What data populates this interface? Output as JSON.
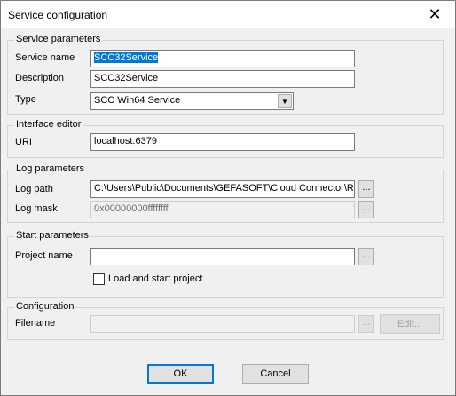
{
  "window": {
    "title": "Service configuration",
    "close_glyph": "✕"
  },
  "service_parameters": {
    "title": "Service parameters",
    "service_name_label": "Service name",
    "service_name_value": "SCC32Service",
    "description_label": "Description",
    "description_value": "SCC32Service",
    "type_label": "Type",
    "type_value": "SCC Win64 Service",
    "dropdown_glyph": "▼"
  },
  "interface_editor": {
    "title": "Interface editor",
    "uri_label": "URI",
    "uri_value": "localhost:6379"
  },
  "log_parameters": {
    "title": "Log parameters",
    "log_path_label": "Log path",
    "log_path_value": "C:\\Users\\Public\\Documents\\GEFASOFT\\Cloud Connector\\R",
    "log_mask_label": "Log mask",
    "log_mask_value": "0x00000000ffffffff",
    "browse_label": "..."
  },
  "start_parameters": {
    "title": "Start parameters",
    "project_name_label": "Project name",
    "project_name_value": "",
    "load_start_label": "Load and start project",
    "browse_label": "..."
  },
  "configuration": {
    "title": "Configuration",
    "filename_label": "Filename",
    "filename_value": "",
    "browse_label": "...",
    "edit_label": "Edit..."
  },
  "buttons": {
    "ok_label": "OK",
    "cancel_label": "Cancel"
  }
}
